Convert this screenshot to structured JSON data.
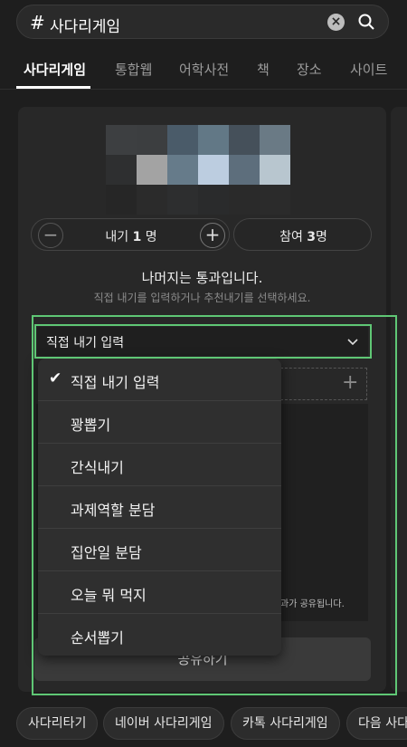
{
  "search": {
    "hash": "#",
    "query": "사다리게임"
  },
  "tabs": [
    "사다리게임",
    "통합웹",
    "어학사전",
    "책",
    "장소",
    "사이트"
  ],
  "pixels": [
    "#3d3f41",
    "#3c3e40",
    "#4a5b69",
    "#627886",
    "#45505a",
    "#6a7a85",
    "#2e2f30",
    "#a3a3a3",
    "#667b8a",
    "#bccde0",
    "#5d6e7c",
    "#b8c6cf",
    "#262626",
    "#2b2b2b",
    "#2d2e2f",
    "#2a2b2c",
    "#2a2a2a",
    "#2b2b2b"
  ],
  "draw": {
    "label": "내기",
    "count": "1",
    "unit": "명"
  },
  "join": {
    "label": "참여",
    "count": "3",
    "unit": "명"
  },
  "message": {
    "title": "나머지는 통과입니다.",
    "subtitle": "직접 내기를 입력하거나 추천내기를 선택하세요."
  },
  "select": {
    "value": "직접 내기 입력"
  },
  "menu": [
    {
      "label": "직접 내기 입력",
      "selected": true
    },
    {
      "label": "꽝뽑기"
    },
    {
      "label": "간식내기"
    },
    {
      "label": "과제역할 분담"
    },
    {
      "label": "집안일 분담"
    },
    {
      "label": "오늘 뭐 먹지"
    },
    {
      "label": "순서뽑기"
    }
  ],
  "footnote": "과가 공유됩니다.",
  "share": "공유하기",
  "chips": [
    "사다리타기",
    "네이버 사다리게임",
    "카톡 사다리게임",
    "다음 사다"
  ],
  "colors": {
    "highlight": "#5fc775",
    "background": "#1e1e1e"
  }
}
